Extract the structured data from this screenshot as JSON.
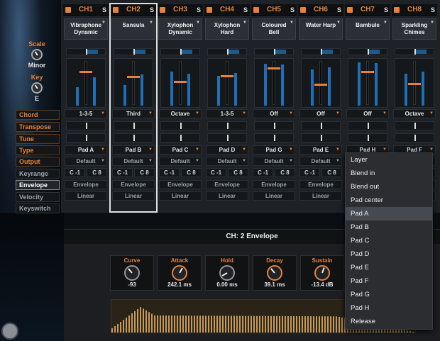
{
  "left_panel": {
    "scale_title": "Scale",
    "scale_value": "Minor",
    "key_title": "Key",
    "key_value": "E",
    "buttons": [
      {
        "label": "Chord",
        "style": "orange"
      },
      {
        "label": "Transpose",
        "style": "orange"
      },
      {
        "label": "Tune",
        "style": "orange"
      },
      {
        "label": "Type",
        "style": "orange"
      },
      {
        "label": "Output",
        "style": "orange"
      },
      {
        "label": "Keyrange",
        "style": "grey"
      },
      {
        "label": "Envelope",
        "style": "active"
      },
      {
        "label": "Velocity",
        "style": "grey"
      },
      {
        "label": "Keyswitch",
        "style": "grey"
      }
    ]
  },
  "channels": [
    {
      "id": "CH1",
      "solo": "S",
      "name1": "Vibraphone",
      "name2": "Dynamic",
      "chord": "1-3-5",
      "pad": "Pad A",
      "output": "Default",
      "range_low": "C -1",
      "range_high": "C 8",
      "env": "Envelope",
      "vel": "Linear",
      "fader_level": 0.78,
      "meter_levels": [
        0.4,
        0.62
      ]
    },
    {
      "id": "CH2",
      "solo": "S",
      "name1": "Sansula",
      "name2": "",
      "chord": "Third",
      "pad": "Pad B",
      "output": "Default",
      "range_low": "C -1",
      "range_high": "C 8",
      "env": "Envelope",
      "vel": "Linear",
      "fader_level": 0.66,
      "meter_levels": [
        0.45,
        0.68
      ]
    },
    {
      "id": "CH3",
      "solo": "S",
      "name1": "Xylophon",
      "name2": "Dynamic",
      "chord": "Octave",
      "pad": "Pad C",
      "output": "Default",
      "range_low": "C -1",
      "range_high": "C 8",
      "env": "Envelope",
      "vel": "Linear",
      "fader_level": 0.55,
      "meter_levels": [
        0.75,
        0.7
      ]
    },
    {
      "id": "CH4",
      "solo": "S",
      "name1": "Xylophon",
      "name2": "Hard",
      "chord": "1-3-5",
      "pad": "Pad D",
      "output": "Default",
      "range_low": "C -1",
      "range_high": "C 8",
      "env": "Envelope",
      "vel": "Linear",
      "fader_level": 0.68,
      "meter_levels": [
        0.65,
        0.72
      ]
    },
    {
      "id": "CH5",
      "solo": "S",
      "name1": "Coloured",
      "name2": "Bell",
      "chord": "Off",
      "pad": "Pad G",
      "output": "Default",
      "range_low": "C -1",
      "range_high": "C 8",
      "env": "Envelope",
      "vel": "Linear",
      "fader_level": 0.85,
      "meter_levels": [
        0.92,
        0.9
      ]
    },
    {
      "id": "CH6",
      "solo": "S",
      "name1": "Water Harp",
      "name2": "",
      "chord": "Off",
      "pad": "Pad E",
      "output": "Default",
      "range_low": "C -1",
      "range_high": "C 8",
      "env": "Envelope",
      "vel": "Linear",
      "fader_level": 0.48,
      "meter_levels": [
        0.8,
        0.85
      ]
    },
    {
      "id": "CH7",
      "solo": "S",
      "name1": "Bambule",
      "name2": "",
      "chord": "Off",
      "pad": "Pad H",
      "output": "Default",
      "range_low": "C -1",
      "range_high": "C 8",
      "env": "Envelope",
      "vel": "Linear",
      "fader_level": 0.78,
      "meter_levels": [
        0.95,
        0.93
      ]
    },
    {
      "id": "CH8",
      "solo": "S",
      "name1": "Sparkling",
      "name2": "Chimes",
      "chord": "Octave",
      "pad": "Pad F",
      "output": "Default",
      "range_low": "C -1",
      "range_high": "C 8",
      "env": "Envelope",
      "vel": "Linear",
      "fader_level": 0.5,
      "meter_levels": [
        0.7,
        0.75
      ]
    }
  ],
  "envelope": {
    "title": "CH: 2  Envelope",
    "params": [
      {
        "label": "Curve",
        "value": "-93",
        "knob": "grey",
        "angle": -40
      },
      {
        "label": "Attack",
        "value": "242.1 ms",
        "knob": "orange",
        "angle": 30
      },
      {
        "label": "Hold",
        "value": "0.00 ms",
        "knob": "grey",
        "angle": -120
      },
      {
        "label": "Decay",
        "value": "39.1 ms",
        "knob": "orange",
        "angle": -40
      },
      {
        "label": "Sustain",
        "value": "-13.4 dB",
        "knob": "orange",
        "angle": 20
      }
    ]
  },
  "menu": {
    "items": [
      "Layer",
      "Blend in",
      "Blend out",
      "Pad center",
      "Pad A",
      "Pad B",
      "Pad C",
      "Pad D",
      "Pad E",
      "Pad F",
      "Pad G",
      "Pad H",
      "Release"
    ],
    "highlighted": "Pad A"
  },
  "colors": {
    "accent": "#e8823a",
    "meter": "#1f6fb8",
    "selection_frame": "#e0e0e0"
  }
}
